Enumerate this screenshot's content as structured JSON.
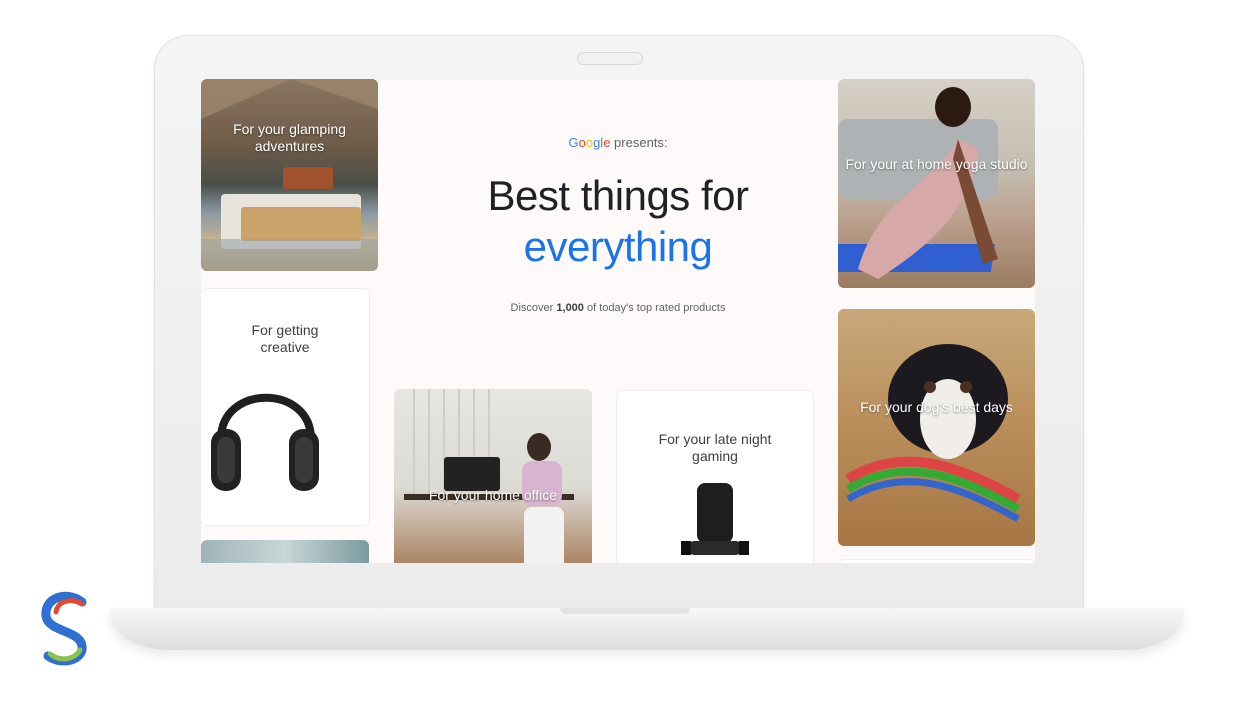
{
  "hero": {
    "brand": "Google",
    "presents": "presents:",
    "title_line1": "Best things for",
    "title_line2": "everything",
    "discover_pre": "Discover",
    "discover_count": "1,000",
    "discover_post": "of today's top rated products"
  },
  "cards": {
    "glamping": "For your glamping adventures",
    "creative": "For getting creative",
    "home_office": "For your home office",
    "gaming": "For your late night gaming",
    "yoga": "For your at home yoga studio",
    "dog": "For your dog's best days"
  },
  "colors": {
    "google_blue": "#4285f4",
    "google_red": "#ea4335",
    "google_yellow": "#fbbc05",
    "google_green": "#34a853",
    "accent_blue": "#1a73e8",
    "title_dark": "#202124"
  }
}
